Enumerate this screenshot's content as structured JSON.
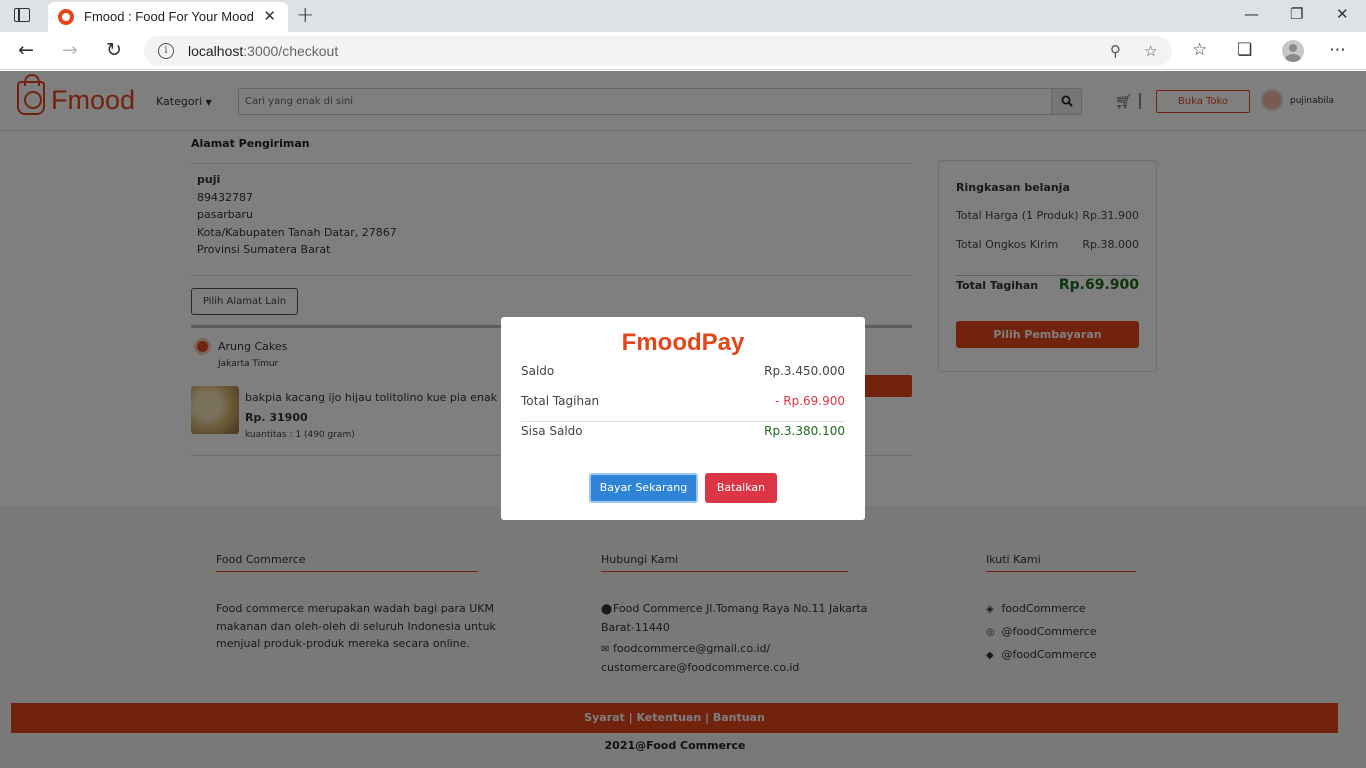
{
  "browser": {
    "tab_title": "Fmood : Food For Your Mood",
    "url_host": "localhost",
    "url_path": ":3000/checkout",
    "tab_close": "✕",
    "new_tab": "+",
    "win_minimize": "—",
    "win_restore": "❐",
    "win_close": "✕"
  },
  "header": {
    "logo": "Fmood",
    "kategori": "Kategori",
    "search_placeholder": "Cari yang enak di sini",
    "buka_toko": "Buka Toko",
    "username": "pujinabila"
  },
  "address": {
    "title": "Alamat Pengiriman",
    "name": "puji",
    "phone": "89432787",
    "street": "pasarbaru",
    "city": "Kota/Kabupaten Tanah Datar, 27867",
    "province": "Provinsi Sumatera Barat",
    "change_button": "Pilih Alamat Lain"
  },
  "order": {
    "store_name": "Arung Cakes",
    "store_location": "Jakarta Timur",
    "product_name": "bakpia kacang ijo hijau tolitolino kue pia enak lezat",
    "product_price": "Rp. 31900",
    "product_qty": "kuantitas : 1 (490 gram)"
  },
  "summary": {
    "title": "Ringkasan belanja",
    "total_harga_label": "Total Harga (1 Produk)",
    "total_harga_value": "Rp.31.900",
    "ongkir_label": "Total Ongkos Kirim",
    "ongkir_value": "Rp.38.000",
    "tagihan_label": "Total Tagihan",
    "tagihan_value": "Rp.69.900",
    "pay_button": "Pilih Pembayaran"
  },
  "footer": {
    "col1_title": "Food Commerce",
    "col1_text": "Food commerce merupakan wadah bagi para UKM makanan dan oleh-oleh di seluruh Indonesia untuk menjual produk-produk mereka secara online.",
    "col2_title": "Hubungi Kami",
    "col2_address": "Food Commerce Jl.Tomang Raya No.11 Jakarta Barat-11440",
    "col2_email1": "foodcommerce@gmail.co.id/",
    "col2_email2": "customercare@foodcommerce.co.id",
    "col3_title": "Ikuti Kami",
    "social1": "foodCommerce",
    "social2": "@foodCommerce",
    "social3": "@foodCommerce",
    "links": "Syarat | Ketentuan | Bantuan",
    "copyright": "2021@Food Commerce"
  },
  "modal": {
    "title": "FmoodPay",
    "saldo_label": "Saldo",
    "saldo_value": "Rp.3.450.000",
    "tagihan_label": "Total Tagihan",
    "tagihan_value": "- Rp.69.900",
    "sisa_label": "Sisa Saldo",
    "sisa_value": "Rp.3.380.100",
    "pay_button": "Bayar Sekarang",
    "cancel_button": "Batalkan"
  },
  "colors": {
    "brand": "#e4461c",
    "negative": "#dc3545",
    "positive": "#1d6b1d",
    "primary_button": "#2f84d8"
  }
}
